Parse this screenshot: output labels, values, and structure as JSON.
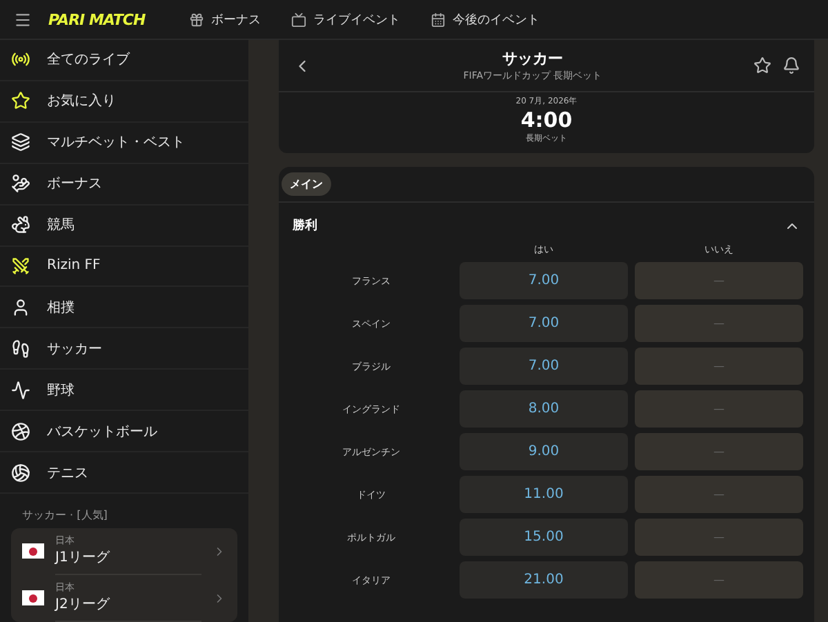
{
  "topbar": {
    "logo": "PARI MATCH",
    "links": [
      {
        "kind": "gift",
        "label": "ボーナス"
      },
      {
        "kind": "live",
        "label": "ライブイベント"
      },
      {
        "kind": "calendar",
        "label": "今後のイベント"
      }
    ]
  },
  "sidebar": {
    "items": [
      {
        "kind": "live",
        "label": "全てのライブ"
      },
      {
        "kind": "star",
        "label": "お気に入り"
      },
      {
        "kind": "multi",
        "label": "マルチベット・ベスト"
      },
      {
        "kind": "bonus",
        "label": "ボーナス"
      },
      {
        "kind": "horse",
        "label": "競馬"
      },
      {
        "kind": "rizin",
        "label": "Rizin FF"
      },
      {
        "kind": "sumo",
        "label": "相撲"
      },
      {
        "kind": "soccer",
        "label": "サッカー"
      },
      {
        "kind": "baseball",
        "label": "野球"
      },
      {
        "kind": "basketball",
        "label": "バスケットボール"
      },
      {
        "kind": "tennis",
        "label": "テニス"
      }
    ],
    "section_title": "サッカー · [人気]",
    "leagues": [
      {
        "country": "日本",
        "name": "J1リーグ"
      },
      {
        "country": "日本",
        "name": "J2リーグ"
      }
    ]
  },
  "event": {
    "title": "サッカー",
    "subtitle": "FIFAワールドカップ 長期ベット",
    "date": "20 7月, 2026年",
    "time": "4:00",
    "type": "長期ベット"
  },
  "market_tabs": [
    {
      "label": "メイン",
      "selected": true
    }
  ],
  "market": {
    "title": "勝利",
    "expanded": true,
    "columns": [
      "はい",
      "いいえ"
    ],
    "rows": [
      {
        "team": "フランス",
        "yes": "7.00",
        "no": "—"
      },
      {
        "team": "スペイン",
        "yes": "7.00",
        "no": "—"
      },
      {
        "team": "ブラジル",
        "yes": "7.00",
        "no": "—"
      },
      {
        "team": "イングランド",
        "yes": "8.00",
        "no": "—"
      },
      {
        "team": "アルゼンチン",
        "yes": "9.00",
        "no": "—"
      },
      {
        "team": "ドイツ",
        "yes": "11.00",
        "no": "—"
      },
      {
        "team": "ポルトガル",
        "yes": "15.00",
        "no": "—"
      },
      {
        "team": "イタリア",
        "yes": "21.00",
        "no": "—"
      }
    ]
  }
}
